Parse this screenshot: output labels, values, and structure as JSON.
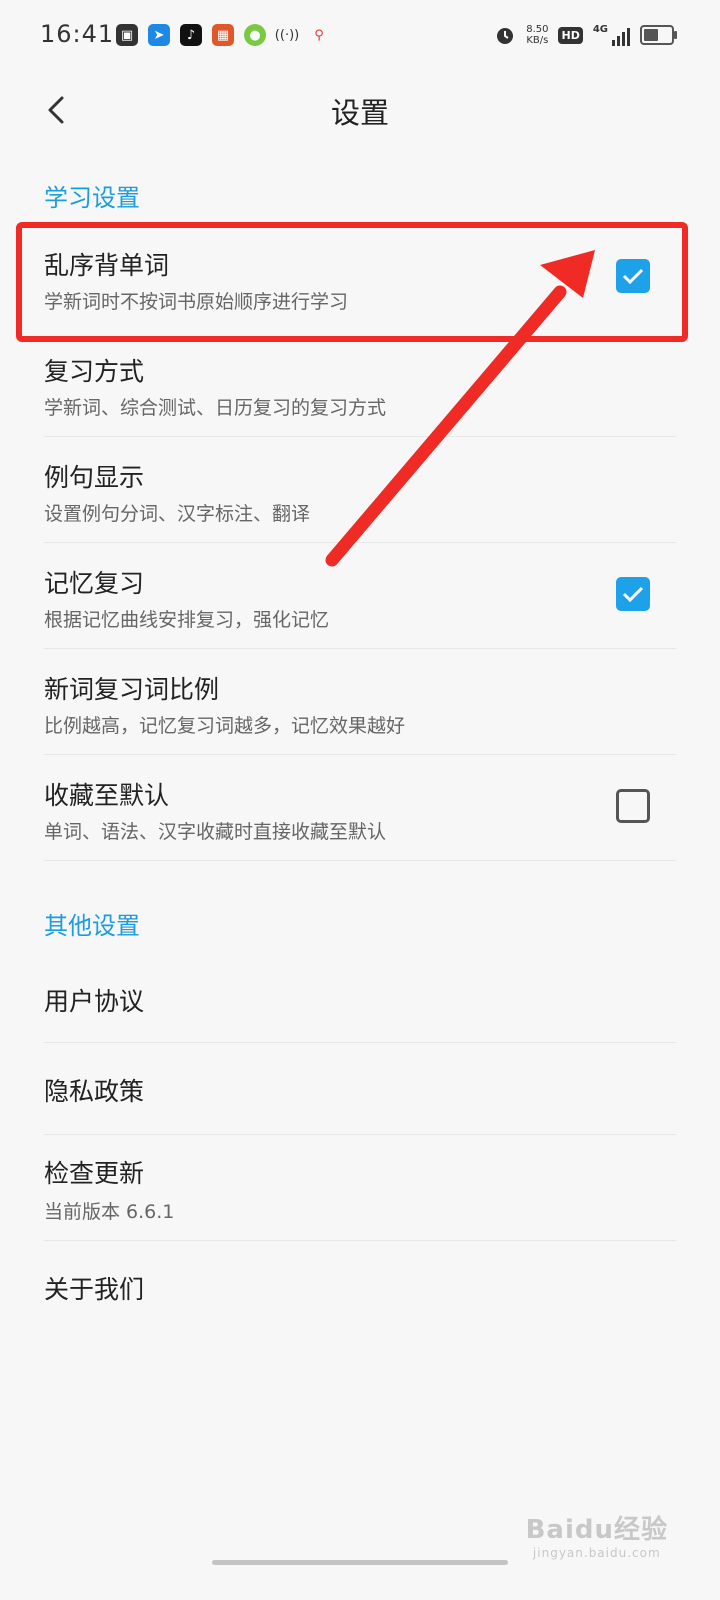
{
  "status_bar": {
    "time": "16:41",
    "net_speed_value": "8.50",
    "net_speed_unit": "KB/s",
    "hd_label": "HD",
    "network_label": "4G",
    "battery_level": 0.45
  },
  "header": {
    "title": "设置"
  },
  "sections": [
    {
      "title": "学习设置",
      "items": [
        {
          "title": "乱序背单词",
          "subtitle": "学新词时不按词书原始顺序进行学习",
          "checkbox": true
        },
        {
          "title": "复习方式",
          "subtitle": "学新词、综合测试、日历复习的复习方式",
          "checkbox": null
        },
        {
          "title": "例句显示",
          "subtitle": "设置例句分词、汉字标注、翻译",
          "checkbox": null
        },
        {
          "title": "记忆复习",
          "subtitle": "根据记忆曲线安排复习，强化记忆",
          "checkbox": true
        },
        {
          "title": "新词复习词比例",
          "subtitle": "比例越高，记忆复习词越多，记忆效果越好",
          "checkbox": null
        },
        {
          "title": "收藏至默认",
          "subtitle": "单词、语法、汉字收藏时直接收藏至默认",
          "checkbox": false
        }
      ]
    },
    {
      "title": "其他设置",
      "items": [
        {
          "title": "用户协议"
        },
        {
          "title": "隐私政策"
        },
        {
          "title": "检查更新",
          "subtitle": "当前版本 6.6.1"
        },
        {
          "title": "关于我们"
        }
      ]
    }
  ],
  "watermark": {
    "main": "Baidu经验",
    "sub": "jingyan.baidu.com"
  },
  "colors": {
    "accent": "#1b9ddb",
    "checkbox_on": "#1da1e8",
    "annotation_red": "#f02a24",
    "background": "#f7f7f7"
  },
  "icons": {
    "back": "chevron-left-icon",
    "checked": "checkmark-icon",
    "alarm": "alarm-icon"
  }
}
